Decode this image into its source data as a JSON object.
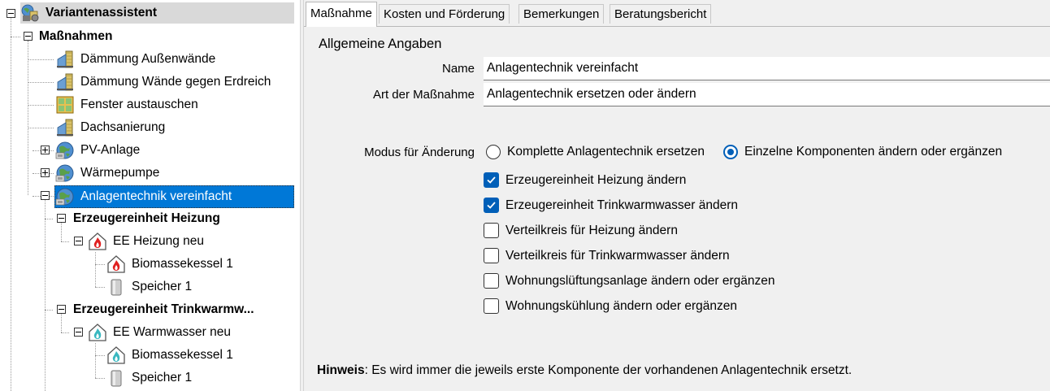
{
  "tree": {
    "root": {
      "label": "Variantenassistent",
      "icon": "variant-assistant-icon"
    },
    "massnahmen": {
      "label": "Maßnahmen"
    },
    "items": [
      {
        "label": "Dämmung Außenwände",
        "icon": "wall-insulation-icon"
      },
      {
        "label": "Dämmung Wände gegen Erdreich",
        "icon": "wall-insulation-icon"
      },
      {
        "label": "Fenster austauschen",
        "icon": "window-icon"
      },
      {
        "label": "Dachsanierung",
        "icon": "roof-insulation-icon"
      },
      {
        "label": "PV-Anlage",
        "icon": "system-globe-icon"
      },
      {
        "label": "Wärmepumpe",
        "icon": "system-globe-icon"
      },
      {
        "label": "Anlagentechnik vereinfacht",
        "icon": "system-globe-icon"
      }
    ],
    "heizung_group": {
      "label": "Erzeugereinheit Heizung"
    },
    "heizung_unit": {
      "label": "EE Heizung neu",
      "icon": "heating-house-icon"
    },
    "heizung_components": [
      {
        "label": "Biomassekessel 1",
        "icon": "biomass-heating-icon"
      },
      {
        "label": "Speicher 1",
        "icon": "storage-tank-icon"
      }
    ],
    "warmwasser_group": {
      "label": "Erzeugereinheit Trinkwarmw..."
    },
    "warmwasser_unit": {
      "label": "EE Warmwasser neu",
      "icon": "hot-water-house-icon"
    },
    "warmwasser_components": [
      {
        "label": "Biomassekessel 1",
        "icon": "biomass-water-icon"
      },
      {
        "label": "Speicher 1",
        "icon": "storage-tank-icon"
      }
    ]
  },
  "tabs": [
    {
      "label": "Maßnahme",
      "active": true
    },
    {
      "label": "Kosten und Förderung",
      "active": false
    },
    {
      "label": "Bemerkungen",
      "active": false
    },
    {
      "label": "Beratungsbericht",
      "active": false
    }
  ],
  "form": {
    "section_title": "Allgemeine Angaben",
    "name_label": "Name",
    "name_value": "Anlagentechnik vereinfacht",
    "art_label": "Art der Maßnahme",
    "art_value": "Anlagentechnik ersetzen oder ändern",
    "mode_label": "Modus für Änderung",
    "mode_options": [
      {
        "label": "Komplette Anlagentechnik ersetzen",
        "selected": false
      },
      {
        "label": "Einzelne Komponenten ändern oder ergänzen",
        "selected": true
      }
    ],
    "checkboxes": [
      {
        "label": "Erzeugereinheit Heizung ändern",
        "checked": true
      },
      {
        "label": "Erzeugereinheit Trinkwarmwasser ändern",
        "checked": true
      },
      {
        "label": "Verteilkreis für Heizung ändern",
        "checked": false
      },
      {
        "label": "Verteilkreis für Trinkwarmwasser ändern",
        "checked": false
      },
      {
        "label": "Wohnungslüftungsanlage ändern oder ergänzen",
        "checked": false
      },
      {
        "label": "Wohnungskühlung ändern oder ergänzen",
        "checked": false
      }
    ],
    "hint_label": "Hinweis",
    "hint_text": ": Es wird immer die jeweils erste Komponente der vorhandenen Anlagentechnik ersetzt."
  },
  "colors": {
    "accent": "#005fb8",
    "selection": "#0078d7",
    "panel_bg": "#f0f0f0"
  }
}
